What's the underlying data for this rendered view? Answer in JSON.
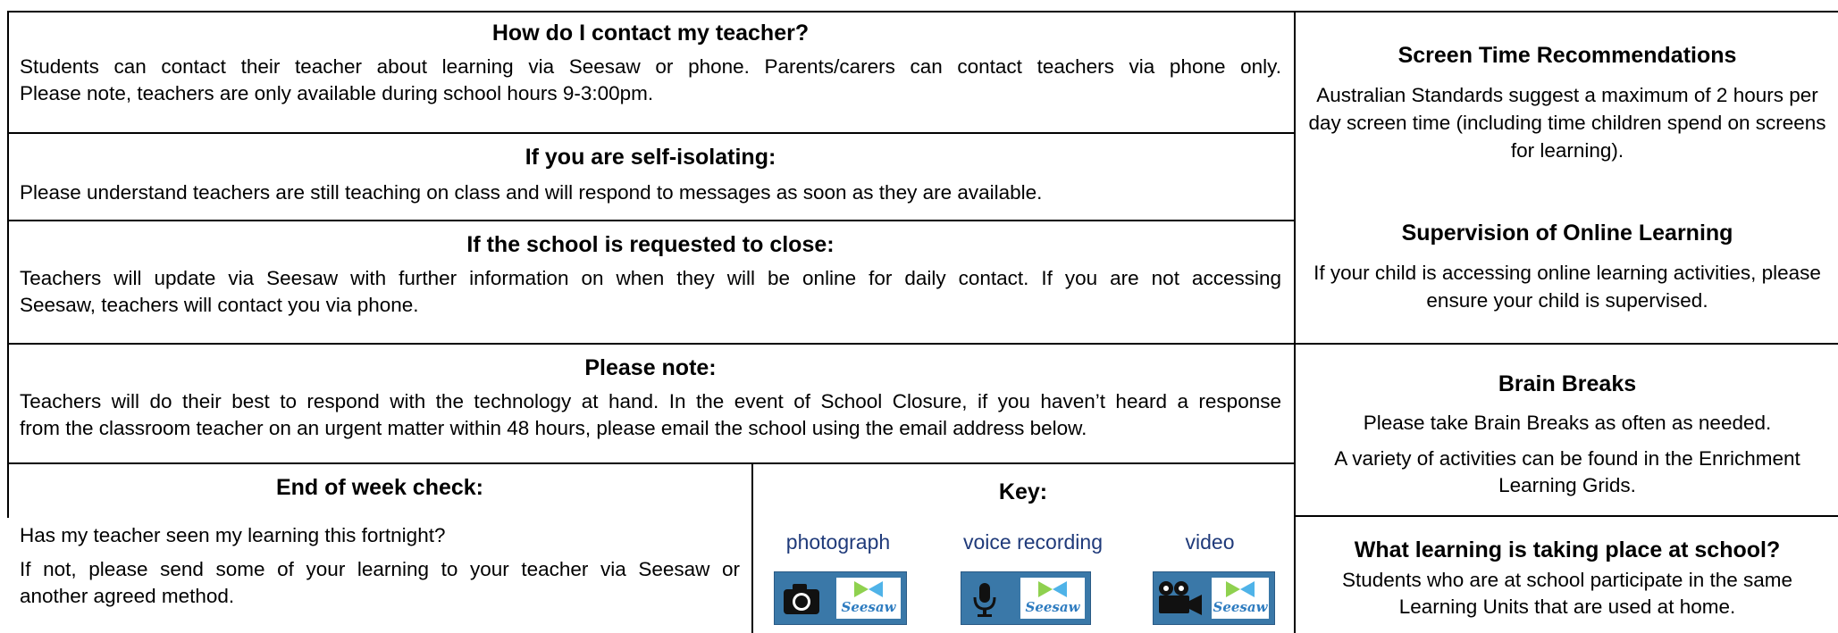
{
  "left": {
    "contact": {
      "title": "How do I contact my teacher?",
      "line1": "Students can contact their teacher about learning via Seesaw or phone. Parents/carers can contact teachers via phone only.",
      "line2": "Please note, teachers are only available during school hours 9-3:00pm."
    },
    "isolating": {
      "title": "If you are self-isolating:",
      "body": "Please understand teachers are still teaching on class and will respond to messages as soon as they are available."
    },
    "closure": {
      "title": "If the school is requested to close:",
      "line1": "Teachers will update via Seesaw with further information on when they will be online for daily contact. If you are not accessing",
      "line2": "Seesaw, teachers will contact you via phone."
    },
    "note": {
      "title": "Please note:",
      "line1": "Teachers will do their best to respond with the technology at hand. In the event of School Closure, if you haven’t heard a response",
      "line2": "from the classroom teacher on an urgent matter within 48 hours, please email the school using the email address below."
    },
    "week_check": {
      "title": "End of week check:",
      "question": "Has my teacher seen my learning this fortnight?",
      "line1": "If not, please send some of your learning to your teacher via Seesaw or",
      "line2": "another agreed method."
    },
    "key": {
      "title": "Key:",
      "items": [
        {
          "label": "photograph",
          "icon": "camera-icon",
          "brand": "Seesaw"
        },
        {
          "label": "voice recording",
          "icon": "microphone-icon",
          "brand": "Seesaw"
        },
        {
          "label": "video",
          "icon": "video-camera-icon",
          "brand": "Seesaw"
        }
      ]
    }
  },
  "right": {
    "screen_time": {
      "title": "Screen Time Recommendations",
      "body": "Australian Standards suggest a maximum of 2 hours per day screen time (including time children spend on screens for learning)."
    },
    "supervision": {
      "title": "Supervision of Online Learning",
      "body": "If your child is accessing online learning activities, please ensure your child is supervised."
    },
    "brain_breaks": {
      "title": "Brain Breaks",
      "body1": "Please take Brain Breaks as often as needed.",
      "body2": "A variety of activities can be found in the Enrichment Learning Grids."
    },
    "learning_school": {
      "title": "What learning is taking place at school?",
      "body": "Students who are at school participate in the same Learning Units that are used at home."
    }
  },
  "colors": {
    "border": "#000000",
    "key_label": "#1f3a7a",
    "badge_blue": "#3a78a8",
    "seesaw_text": "#2e7cc0"
  }
}
